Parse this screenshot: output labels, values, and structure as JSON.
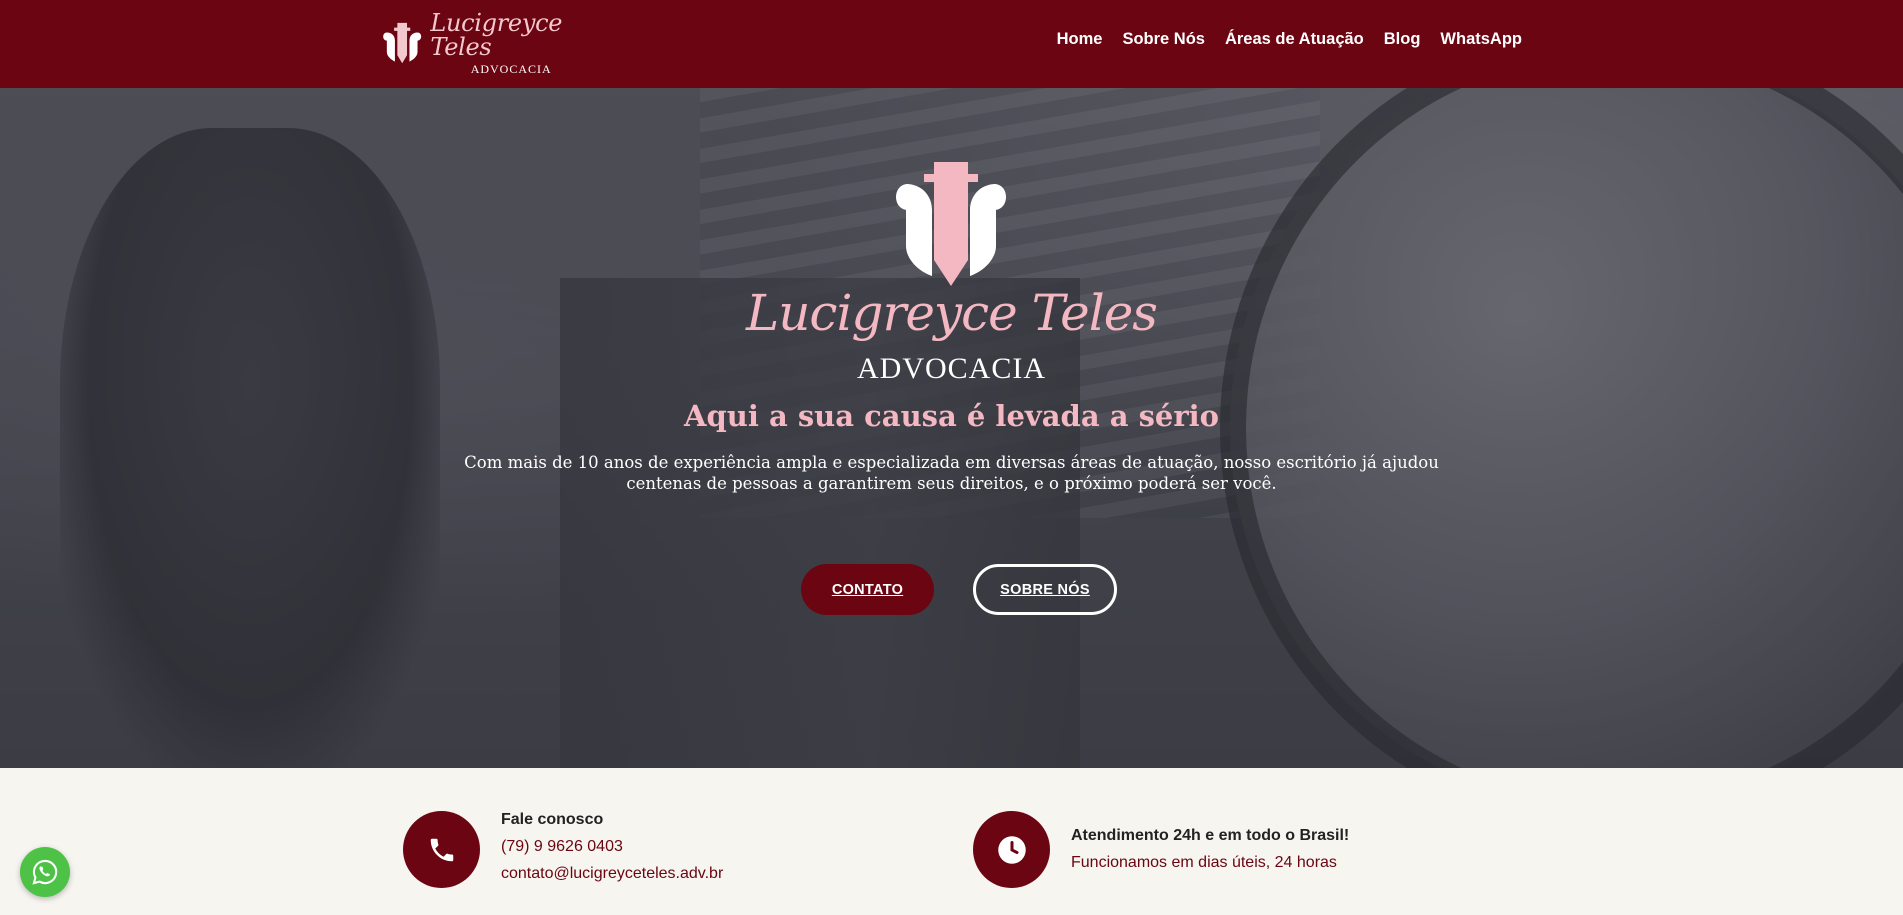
{
  "header": {
    "brand_name": "Lucigreyce Teles",
    "brand_sub": "ADVOCACIA",
    "nav": [
      "Home",
      "Sobre Nós",
      "Áreas de Atuação",
      "Blog",
      "WhatsApp"
    ]
  },
  "hero": {
    "brand_name": "Lucigreyce Teles",
    "brand_sub": "ADVOCACIA",
    "title": "Aqui a sua causa é levada a sério",
    "description": "Com mais de 10 anos de experiência ampla e especializada em diversas áreas de atuação, nosso escritório já ajudou centenas de pessoas a garantirem seus direitos, e o próximo poderá ser você.",
    "buttons": {
      "contato": "CONTATO",
      "sobre": "SOBRE NÓS"
    }
  },
  "info": {
    "contact": {
      "title": "Fale conosco",
      "phone": "(79) 9 9626 0403",
      "email": "contato@lucigreyceteles.adv.br",
      "icon": "phone-icon"
    },
    "hours": {
      "title": "Atendimento 24h e em todo o Brasil!",
      "subtitle": "Funcionamos em dias úteis, 24 horas",
      "icon": "clock-icon"
    }
  },
  "colors": {
    "brand": "#6b0512",
    "accent_pink": "#f3b8c2",
    "whatsapp": "#4dc247"
  }
}
